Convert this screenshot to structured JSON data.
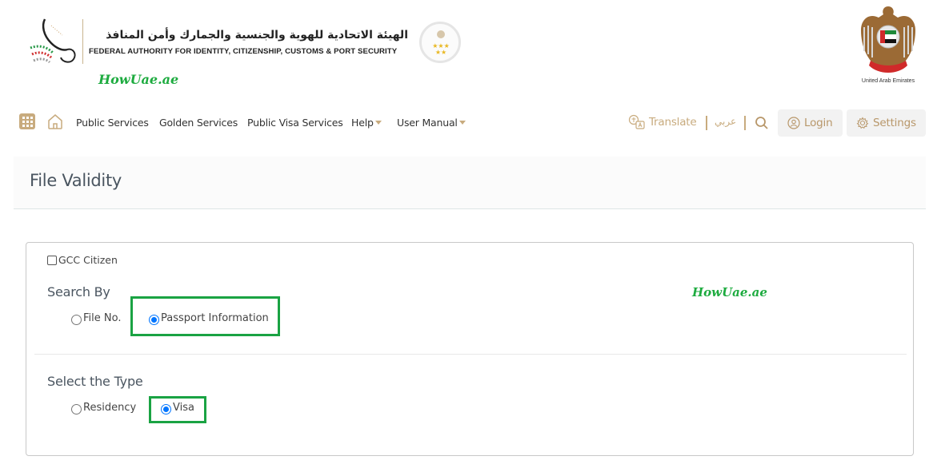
{
  "header": {
    "org_name_ar": "الهيئة الاتحادية للهوية والجنسية والجمارك وأمن المنافذ",
    "org_name_en": "FEDERAL AUTHORITY FOR IDENTITY, CITIZENSHIP, CUSTOMS & PORT SECURITY",
    "seal_stars": "★★★ ★★",
    "watermark": "HowUae.ae",
    "emblem_caption": "United Arab Emirates"
  },
  "nav": {
    "items": [
      {
        "label": "Public Services"
      },
      {
        "label": "Golden Services"
      },
      {
        "label": "Public Visa Services"
      },
      {
        "label": "Help",
        "dropdown": true
      },
      {
        "label": "User Manual",
        "dropdown": true
      }
    ],
    "translate_label": "Translate",
    "arabic_label": "عربي",
    "login_label": "Login",
    "settings_label": "Settings",
    "accent_color": "#c8ab7e"
  },
  "page": {
    "title": "File Validity"
  },
  "form": {
    "gcc_citizen": {
      "label": "GCC Citizen",
      "checked": false
    },
    "search_by": {
      "label": "Search By",
      "options": [
        {
          "label": "File No.",
          "checked": false
        },
        {
          "label": "Passport Information",
          "checked": true
        }
      ]
    },
    "select_type": {
      "label": "Select the Type",
      "options": [
        {
          "label": "Residency",
          "checked": false
        },
        {
          "label": "Visa",
          "checked": true
        }
      ]
    },
    "watermark": "HowUae.ae",
    "highlight_color": "#1aa343"
  }
}
